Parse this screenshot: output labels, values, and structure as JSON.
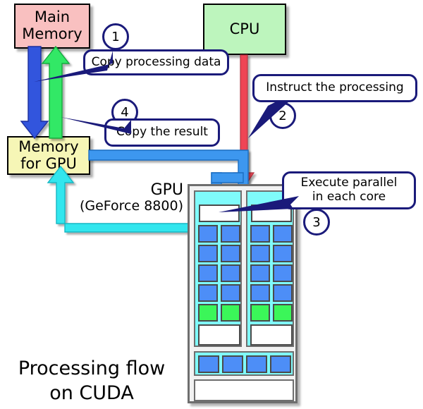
{
  "diagram": {
    "caption": "Processing flow\non CUDA",
    "gpu_label_line1": "GPU",
    "gpu_label_line2": "(GeForce 8800)"
  },
  "nodes": [
    {
      "id": "main-memory",
      "label": "Main\nMemory",
      "color": "#f9c0c0"
    },
    {
      "id": "cpu",
      "label": "CPU",
      "color": "#bdf5bd"
    },
    {
      "id": "memory-gpu",
      "label": "Memory\nfor GPU",
      "color": "#f6f6b6"
    }
  ],
  "steps": [
    {
      "number": "1",
      "text": "Copy processing data"
    },
    {
      "number": "2",
      "text": "Instruct the processing"
    },
    {
      "number": "3",
      "text": "Execute parallel\nin each core"
    },
    {
      "number": "4",
      "text": "Copy the result"
    }
  ],
  "arrows": [
    {
      "id": "main-to-gpumem",
      "color": "#3355dd",
      "direction": "down",
      "meaning": "copy processing data"
    },
    {
      "id": "gpumem-to-main",
      "color": "#33e866",
      "direction": "up",
      "meaning": "copy the result"
    },
    {
      "id": "cpu-to-gpu",
      "color": "#ef4455",
      "direction": "down",
      "meaning": "instruct the processing"
    },
    {
      "id": "gpumem-to-cores",
      "color": "#3d97ef",
      "direction": "down",
      "meaning": "feed cores"
    },
    {
      "id": "cores-to-gpumem",
      "color": "#33e6ee",
      "direction": "up",
      "meaning": "return result"
    }
  ],
  "colors": {
    "bubble_border": "#1a1a7a",
    "chassis": "#6e6e6e",
    "mp_fill": "#7ffbfb",
    "core_blue": "#4d8ef7",
    "core_green": "#3bf659",
    "core_white": "#ffffff"
  },
  "gpu": {
    "multiprocessors": [
      {
        "id": "mp-left",
        "rows": [
          "white",
          "blue",
          "blue",
          "blue",
          "blue",
          "green",
          "white"
        ]
      },
      {
        "id": "mp-right",
        "rows": [
          "white",
          "blue",
          "blue",
          "blue",
          "blue",
          "green",
          "white"
        ]
      }
    ],
    "bus_units": [
      "blue",
      "blue",
      "blue",
      "blue"
    ],
    "bottom_slab": "white"
  }
}
